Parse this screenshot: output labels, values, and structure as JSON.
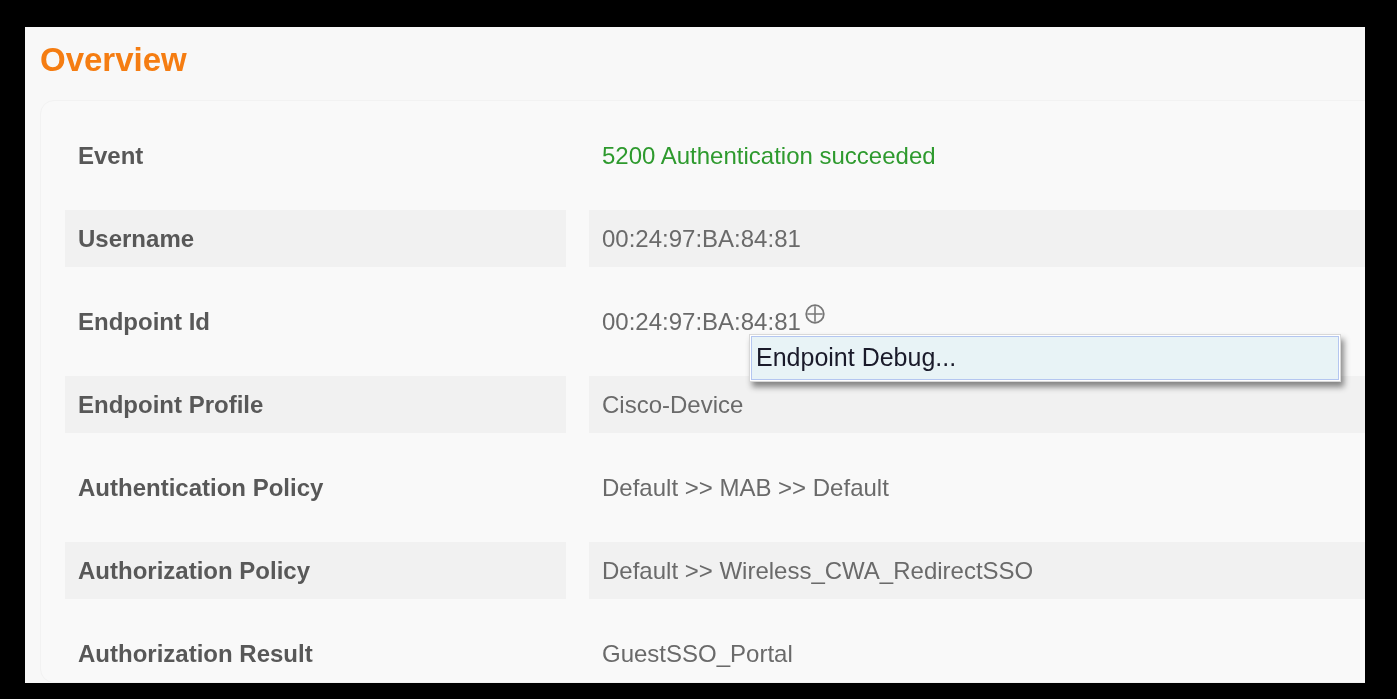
{
  "title": "Overview",
  "rows": [
    {
      "label": "Event",
      "value": "5200 Authentication succeeded",
      "kind": "success"
    },
    {
      "label": "Username",
      "value": "00:24:97:BA:84:81",
      "kind": "text"
    },
    {
      "label": "Endpoint Id",
      "value": "00:24:97:BA:84:81",
      "kind": "target"
    },
    {
      "label": "Endpoint Profile",
      "value": "Cisco-Device",
      "kind": "text"
    },
    {
      "label": "Authentication Policy",
      "value": "Default >> MAB >> Default",
      "kind": "text"
    },
    {
      "label": "Authorization Policy",
      "value": "Default >> Wireless_CWA_RedirectSSO",
      "kind": "text"
    },
    {
      "label": "Authorization Result",
      "value": "GuestSSO_Portal",
      "kind": "text"
    }
  ],
  "context_menu": {
    "items": [
      {
        "label": "Endpoint Debug...",
        "selected": true
      }
    ]
  }
}
